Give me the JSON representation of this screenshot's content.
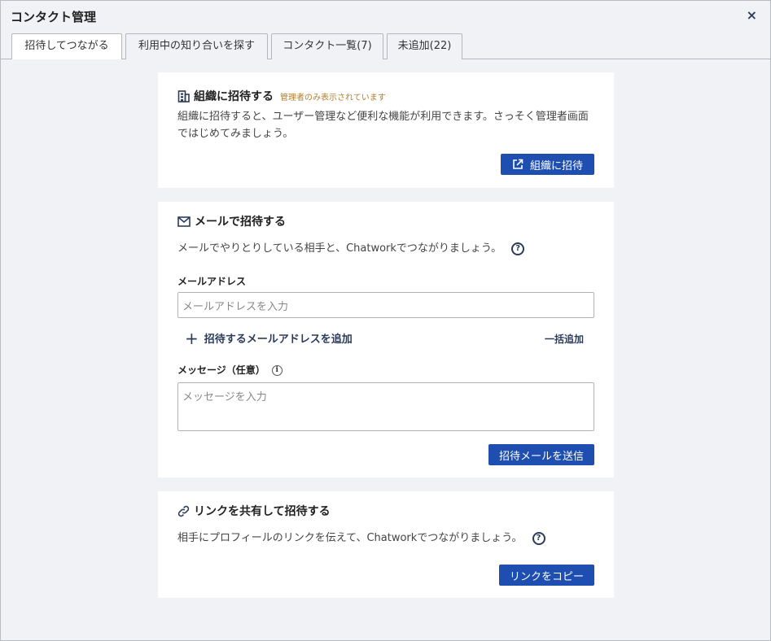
{
  "dialog": {
    "title": "コンタクト管理",
    "close_glyph": "×"
  },
  "tabs": [
    {
      "label": "招待してつながる",
      "active": true
    },
    {
      "label": "利用中の知り合いを探す",
      "active": false
    },
    {
      "label": "コンタクト一覧(7)",
      "active": false
    },
    {
      "label": "未追加(22)",
      "active": false
    }
  ],
  "org_card": {
    "icon": "building-icon",
    "title": "組織に招待する",
    "admin_note": "管理者のみ表示されています",
    "description_line1": "組織に招待すると、ユーザー管理など便利な機能が利用できます。さっそく管理者画面",
    "description_line2": "ではじめてみましょう。",
    "button_icon": "external-link-icon",
    "button_label": "組織に招待"
  },
  "email_card": {
    "icon": "mail-icon",
    "title": "メールで招待する",
    "description": "メールでやりとりしている相手と、Chatworkでつながりましょう。",
    "help_glyph": "?",
    "email_label": "メールアドレス",
    "email_placeholder": "メールアドレスを入力",
    "add_email_label": "招待するメールアドレスを追加",
    "bulk_add_label": "一括追加",
    "message_label": "メッセージ（任意）",
    "info_glyph": "i",
    "message_placeholder": "メッセージを入力",
    "send_button_label": "招待メールを送信"
  },
  "link_card": {
    "icon": "link-icon",
    "title": "リンクを共有して招待する",
    "description": "相手にプロフィールのリンクを伝えて、Chatworkでつながりましょう。",
    "help_glyph": "?",
    "copy_button_label": "リンクをコピー"
  },
  "colors": {
    "primary_button": "#1e4fb0",
    "admin_note": "#b3802f",
    "background": "#f0f2f5"
  }
}
